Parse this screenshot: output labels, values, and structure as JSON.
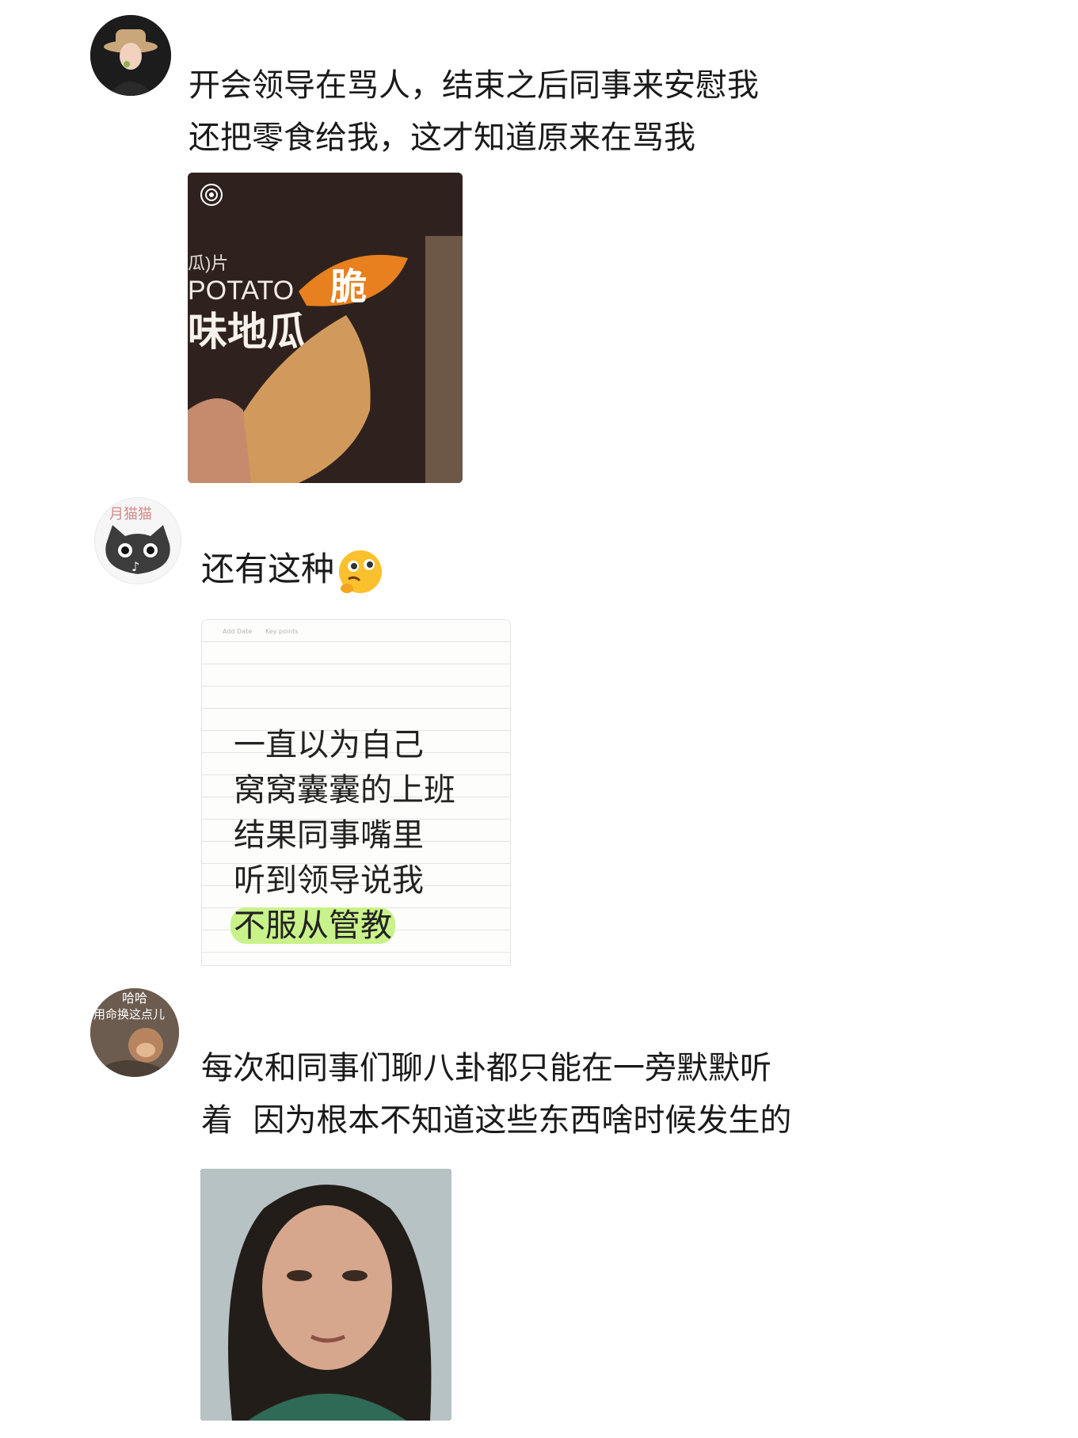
{
  "posts": [
    {
      "avatar": "woman-portrait-avatar",
      "lines": [
        "开会领导在骂人，结束之后同事来安慰我",
        "还把零食给我，这才知道原来在骂我"
      ],
      "image": {
        "description_icon": "live-photo-icon",
        "bag_text_line1": "瓜)片",
        "bag_text_line2": "POTATO",
        "bag_text_line3": "味地瓜",
        "badge": "脆"
      }
    },
    {
      "avatar_text": "月猫猫",
      "text": "还有这种",
      "emoji": "thinking-drool-emoji",
      "note": {
        "header_left": "Add Date",
        "header_right": "Key points",
        "lines": [
          "一直以为自己",
          "窝窝囊囊的上班",
          "结果同事嘴里",
          "听到领导说我"
        ],
        "highlight": "不服从管教"
      }
    },
    {
      "avatar_text_line1": "哈哈",
      "avatar_text_line2": "用命换这点儿",
      "lines": [
        "每次和同事们聊八卦都只能在一旁默默听",
        "着  因为根本不知道这些东西啥时候发生的"
      ],
      "image": "woman-face-photo"
    }
  ],
  "colors": {
    "highlight": "#c9f28a",
    "badge_orange": "#e8801f"
  }
}
